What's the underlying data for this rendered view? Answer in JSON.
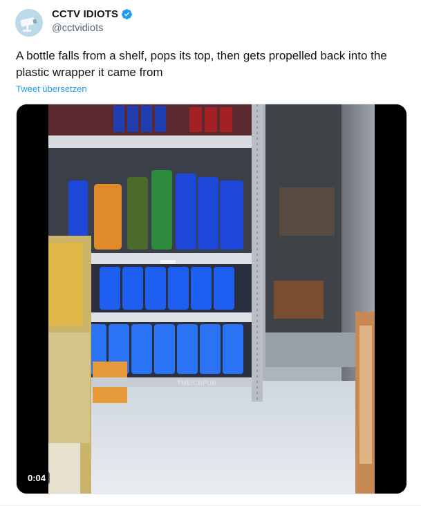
{
  "tweet": {
    "author": {
      "display_name": "CCTV IDIOTS",
      "handle": "@cctvidiots",
      "verified": true,
      "avatar_icon": "cctv-camera-avatar"
    },
    "text": "A bottle falls from a shelf, pops its top, then gets propelled back into the plastic wrapper it came from",
    "translate_link": "Tweet übersetzen",
    "media": {
      "type": "video",
      "duration_label": "0:04",
      "watermark": "TME/CBPUB"
    }
  },
  "colors": {
    "link_blue": "#1d9bf0",
    "verified_blue": "#1d9bf0",
    "secondary_text": "#536471"
  }
}
